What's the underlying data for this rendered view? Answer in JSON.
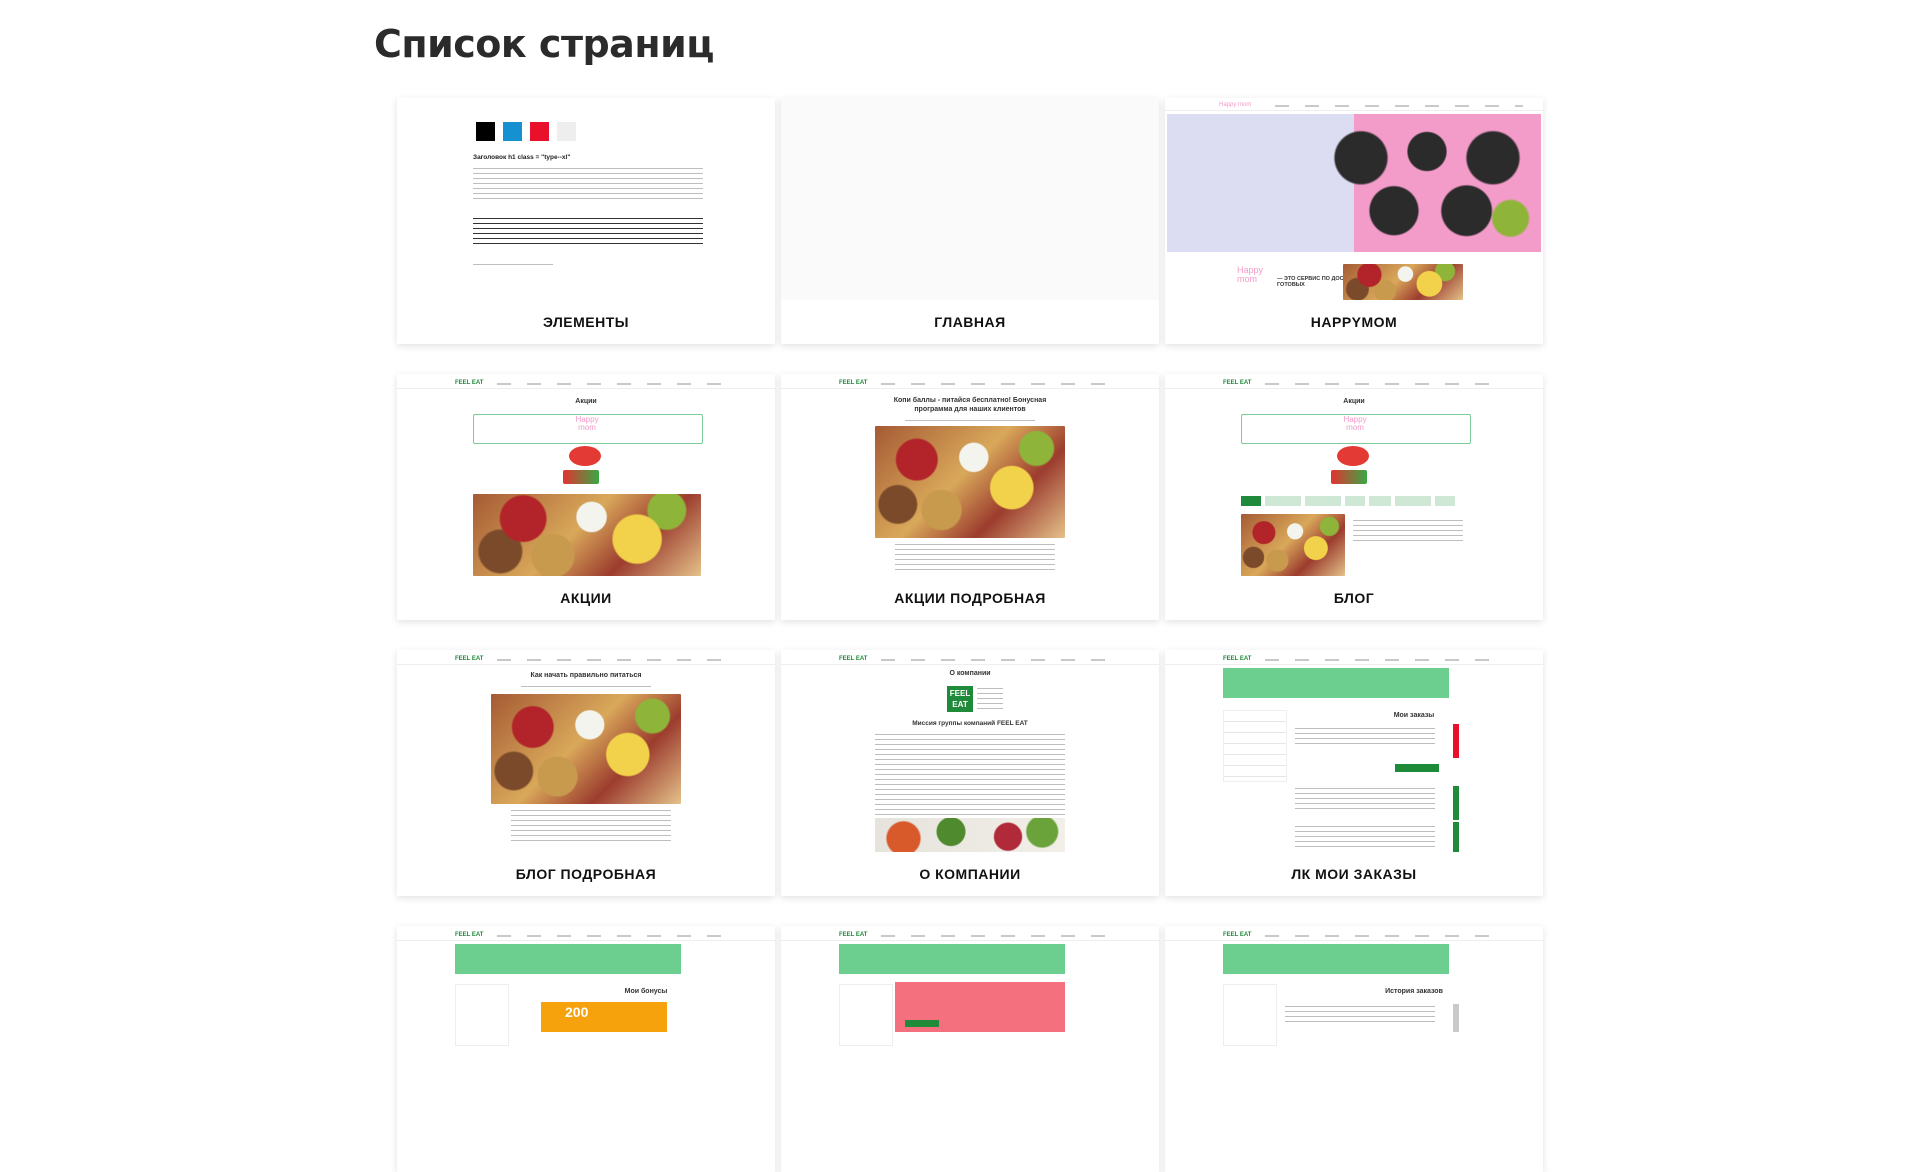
{
  "page_title": "Список страниц",
  "cards": [
    {
      "label": "ЭЛЕМЕНТЫ"
    },
    {
      "label": "ГЛАВНАЯ"
    },
    {
      "label": "HAPPYMOM"
    },
    {
      "label": "АКЦИИ"
    },
    {
      "label": "АКЦИИ ПОДРОБНАЯ"
    },
    {
      "label": "БЛОГ"
    },
    {
      "label": "БЛОГ ПОДРОБНАЯ"
    },
    {
      "label": "О КОМПАНИИ"
    },
    {
      "label": "ЛК МОИ ЗАКАЗЫ"
    },
    {
      "label": ""
    },
    {
      "label": ""
    },
    {
      "label": ""
    }
  ],
  "thumbs": {
    "elements_heading": "Заголовок h1 class = \"type--xl\"",
    "happymom_logo": "Happy mom",
    "happymom_tagline": "— ЭТО СЕРВИС ПО ДОСТАВКЕ ГОТОВЫХ",
    "feel_eat_logo": "FEEL EAT",
    "akcii_title": "Акции",
    "akcii_detail_title": "Копи баллы - питайся бесплатно! Бонусная программа для наших клиентов",
    "blog_detail_title": "Как начать правильно питаться",
    "about_title": "О компании",
    "about_mission": "Миссия группы компаний FEEL EAT",
    "orders_title": "Мои заказы",
    "bonus_title": "Мои бонусы",
    "bonus_value": "200",
    "history_title": "История заказов"
  },
  "colors": {
    "accent_green": "#1f8a3a",
    "light_green": "#6dcf8f",
    "pink": "#f49bc8",
    "swatches": [
      "#000000",
      "#1591d1",
      "#e8102a",
      "#eeeeee"
    ]
  }
}
